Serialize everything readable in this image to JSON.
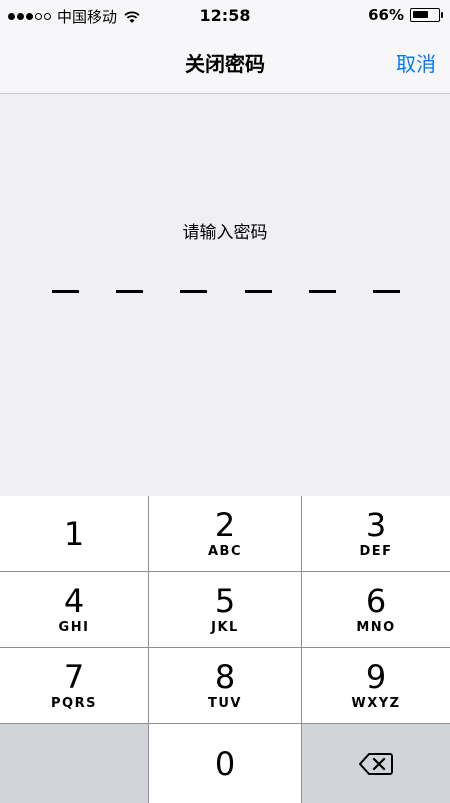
{
  "status": {
    "signal_bars": [
      true,
      true,
      true,
      false,
      false
    ],
    "carrier": "中国移动",
    "time": "12:58",
    "battery_percent": "66%",
    "battery_level": 0.66
  },
  "nav": {
    "title": "关闭密码",
    "cancel": "取消"
  },
  "passcode": {
    "prompt": "请输入密码",
    "length": 6
  },
  "keypad": [
    {
      "num": "1",
      "letters": ""
    },
    {
      "num": "2",
      "letters": "ABC"
    },
    {
      "num": "3",
      "letters": "DEF"
    },
    {
      "num": "4",
      "letters": "GHI"
    },
    {
      "num": "5",
      "letters": "JKL"
    },
    {
      "num": "6",
      "letters": "MNO"
    },
    {
      "num": "7",
      "letters": "PQRS"
    },
    {
      "num": "8",
      "letters": "TUV"
    },
    {
      "num": "9",
      "letters": "WXYZ"
    },
    {
      "num": "0",
      "letters": ""
    }
  ]
}
